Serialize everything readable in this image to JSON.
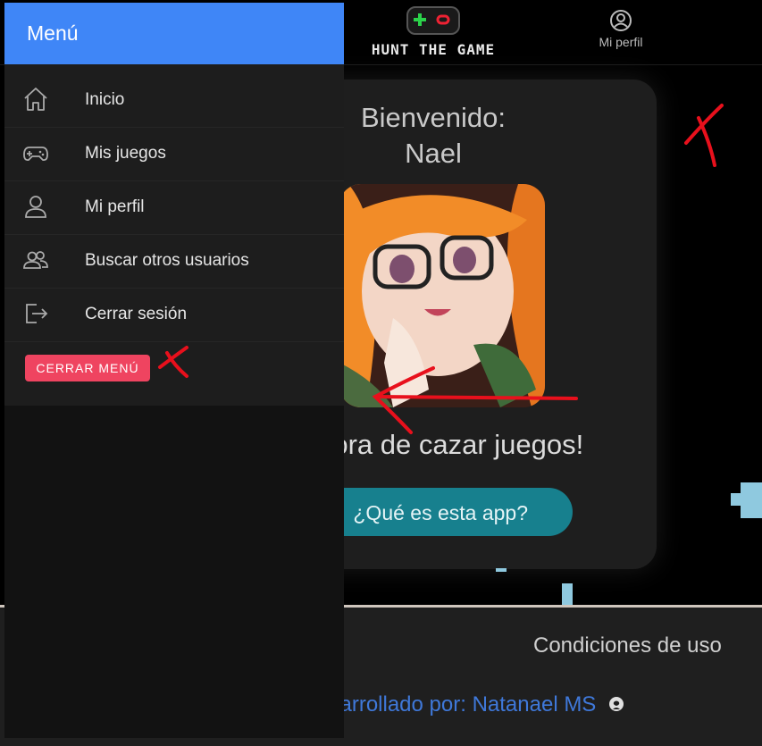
{
  "header": {
    "logo_text": "HUNT THE GAME",
    "profile_label": "Mi perfil"
  },
  "main": {
    "welcome_line1": "Bienvenido:",
    "welcome_line2": "Nael",
    "tagline": "¡Es hora de cazar juegos!",
    "what_is_button": "¿Qué es esta app?"
  },
  "footer": {
    "terms_link": "Condiciones de uso",
    "credit_prefix": "Desarrollado por: ",
    "credit_name": "Natanael MS"
  },
  "menu": {
    "title": "Menú",
    "items": [
      {
        "label": "Inicio",
        "icon": "home-icon"
      },
      {
        "label": "Mis juegos",
        "icon": "gamepad-icon"
      },
      {
        "label": "Mi perfil",
        "icon": "user-icon"
      },
      {
        "label": "Buscar otros usuarios",
        "icon": "users-icon"
      },
      {
        "label": "Cerrar sesión",
        "icon": "logout-icon"
      }
    ],
    "close_button": "CERRAR MENÚ"
  },
  "colors": {
    "menu_header": "#3f86f7",
    "close_button": "#ef4460",
    "app_button": "#17808e",
    "link": "#3f78d9",
    "annotation": "#e8101c"
  }
}
